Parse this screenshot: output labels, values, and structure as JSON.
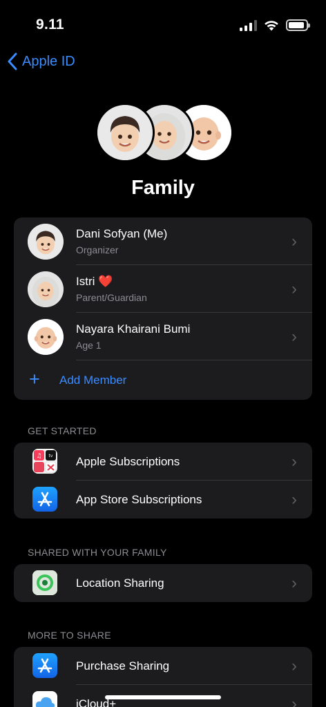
{
  "status_bar": {
    "time": "9.11"
  },
  "nav": {
    "back_label": "Apple ID"
  },
  "header": {
    "title": "Family"
  },
  "members": [
    {
      "name": "Dani Sofyan (Me)",
      "role": "Organizer",
      "avatar": "boy-memoji"
    },
    {
      "name": "Istri",
      "emoji": "❤️",
      "role": "Parent/Guardian",
      "avatar": "hijab-memoji"
    },
    {
      "name": "Nayara Khairani Bumi",
      "role": "Age 1",
      "avatar": "baby-memoji"
    }
  ],
  "add_member": {
    "icon": "plus",
    "label": "Add Member"
  },
  "sections": {
    "get_started": {
      "header": "GET STARTED",
      "items": [
        {
          "label": "Apple Subscriptions",
          "icon": "apple-subscriptions-icon"
        },
        {
          "label": "App Store Subscriptions",
          "icon": "app-store-icon"
        }
      ]
    },
    "shared": {
      "header": "SHARED WITH YOUR FAMILY",
      "items": [
        {
          "label": "Location Sharing",
          "icon": "find-my-icon"
        }
      ]
    },
    "more": {
      "header": "MORE TO SHARE",
      "items": [
        {
          "label": "Purchase Sharing",
          "icon": "app-store-icon"
        },
        {
          "label": "iCloud+",
          "icon": "icloud-icon"
        }
      ]
    }
  },
  "colors": {
    "accent": "#3A8CFF",
    "card_bg": "#1C1C1E",
    "secondary_text": "#8D8D93",
    "separator": "#38383A"
  }
}
